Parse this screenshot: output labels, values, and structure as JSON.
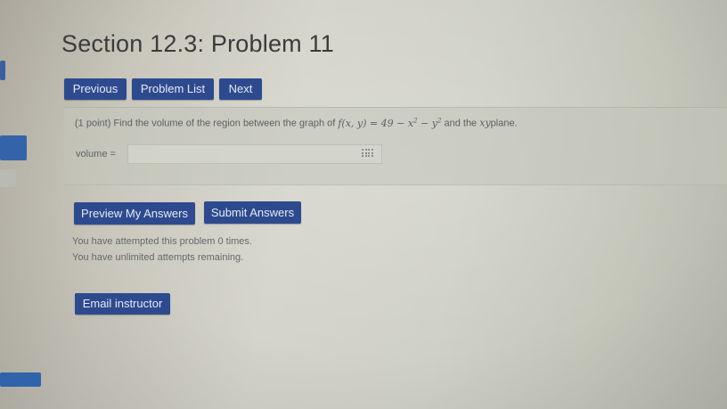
{
  "page": {
    "title": "Section 12.3: Problem 11"
  },
  "nav": {
    "previous_label": "Previous",
    "problem_list_label": "Problem List",
    "next_label": "Next"
  },
  "problem": {
    "prefix": "(1 point) Find the volume of the region between the graph of ",
    "formula": "f(x, y) = 49 − x",
    "exp1": "2",
    "formula_mid": " − y",
    "exp2": "2",
    "suffix_text": " and the ",
    "plane_var": "xy",
    "plane_word": "plane."
  },
  "answer": {
    "label": "volume =",
    "value": "",
    "placeholder": ""
  },
  "actions": {
    "preview_label": "Preview My Answers",
    "submit_label": "Submit Answers"
  },
  "status": {
    "attempts_line": "You have attempted this problem 0 times.",
    "remaining_line": "You have unlimited attempts remaining."
  },
  "footer": {
    "email_label": "Email instructor"
  },
  "colors": {
    "button_bg": "#2e4a8f",
    "button_text": "#e6eaf4",
    "left_tab_blue": "#3563aa"
  },
  "icons": {
    "keypad": "keypad-icon"
  }
}
